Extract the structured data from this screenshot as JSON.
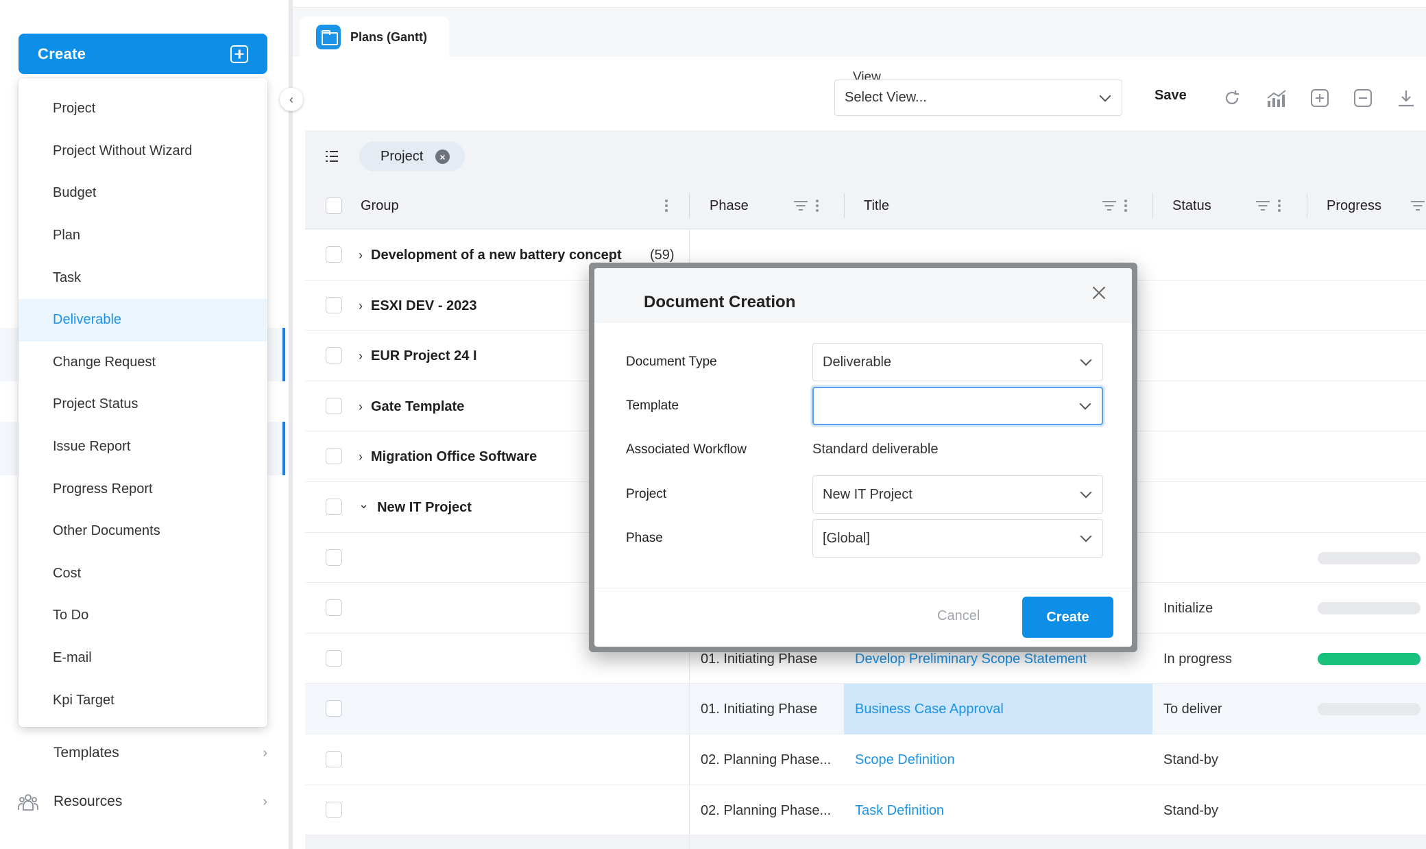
{
  "sidebar": {
    "create_label": "Create",
    "create_menu": [
      {
        "label": "Project"
      },
      {
        "label": "Project Without Wizard"
      },
      {
        "label": "Budget"
      },
      {
        "label": "Plan"
      },
      {
        "label": "Task"
      },
      {
        "label": "Deliverable",
        "active": true
      },
      {
        "label": "Change Request"
      },
      {
        "label": "Project Status"
      },
      {
        "label": "Issue Report"
      },
      {
        "label": "Progress Report"
      },
      {
        "label": "Other Documents"
      },
      {
        "label": "Cost"
      },
      {
        "label": "To Do"
      },
      {
        "label": "E-mail"
      },
      {
        "label": "Kpi Target"
      }
    ],
    "nav": [
      {
        "label": "Templates"
      },
      {
        "label": "Resources",
        "icon": "people-icon"
      }
    ]
  },
  "tab": {
    "label": "Plans (Gantt)",
    "icon": "folder-icon"
  },
  "toolbar": {
    "view_label": "View",
    "view_placeholder": "Select View...",
    "save_label": "Save",
    "tools": [
      "refresh-icon",
      "chart-icon",
      "expand-all-icon",
      "collapse-all-icon",
      "download-icon"
    ]
  },
  "filter": {
    "chip_label": "Project"
  },
  "table": {
    "columns": {
      "group": "Group",
      "phase": "Phase",
      "title": "Title",
      "status": "Status",
      "progress": "Progress"
    },
    "groups": [
      {
        "label": "Development of a new battery concept",
        "count": "(59)",
        "expanded": false
      },
      {
        "label": "ESXI DEV - 2023",
        "expanded": false
      },
      {
        "label": "EUR Project 24 I",
        "expanded": false
      },
      {
        "label": "Gate Template",
        "expanded": false
      },
      {
        "label": "Migration Office Software",
        "expanded": false
      },
      {
        "label": "New IT Project",
        "expanded": true
      }
    ],
    "rows": [
      {
        "phase": "",
        "title": "",
        "status": "",
        "progress": 0
      },
      {
        "phase": "",
        "title": "",
        "status": "Initialize",
        "progress": 0
      },
      {
        "phase": "01. Initiating Phase",
        "title": "Develop Preliminary Scope Statement",
        "status": "In progress",
        "progress": 100
      },
      {
        "phase": "01. Initiating Phase",
        "title": "Business Case Approval",
        "status": "To deliver",
        "progress": 0
      },
      {
        "phase": "02. Planning Phase...",
        "title": "Scope Definition",
        "status": "Stand-by"
      },
      {
        "phase": "02. Planning Phase...",
        "title": "Task Definition",
        "status": "Stand-by"
      }
    ]
  },
  "dialog": {
    "title": "Document Creation",
    "fields": {
      "document_type_label": "Document Type",
      "document_type_value": "Deliverable",
      "template_label": "Template",
      "template_value": "",
      "workflow_label": "Associated Workflow",
      "workflow_value": "Standard deliverable",
      "project_label": "Project",
      "project_value": "New IT Project",
      "phase_label": "Phase",
      "phase_value": "[Global]"
    },
    "cancel_label": "Cancel",
    "create_label": "Create"
  },
  "colors": {
    "accent": "#0d8fe8",
    "link": "#1b93e6",
    "progress_done": "#19c17c",
    "row_highlight": "#cfe6fb"
  }
}
